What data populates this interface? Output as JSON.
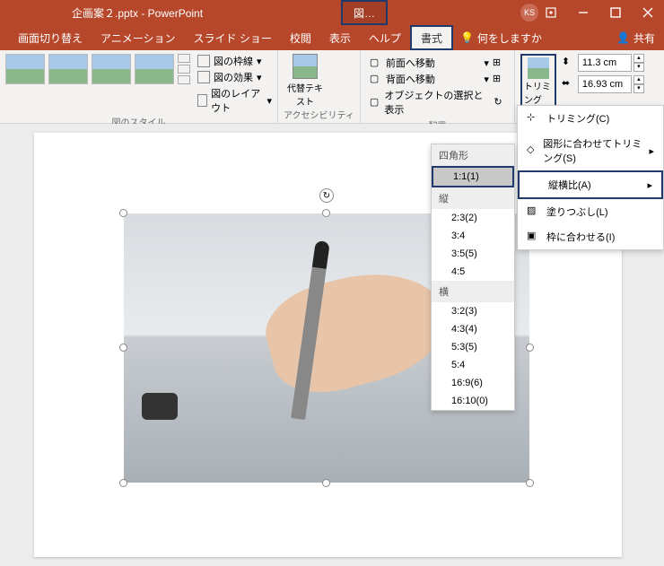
{
  "titlebar": {
    "title": "企画案２.pptx - PowerPoint",
    "context_tab": "図…",
    "user_initials": "KS"
  },
  "menubar": {
    "tabs": [
      "画面切り替え",
      "アニメーション",
      "スライド ショー",
      "校閲",
      "表示",
      "ヘルプ",
      "書式"
    ],
    "tell_me": "何をしますか",
    "share": "共有"
  },
  "ribbon": {
    "style_group": "図のスタイル",
    "pic_border": "図の枠線",
    "pic_effects": "図の効果",
    "pic_layout": "図のレイアウト",
    "alt_text_group": "アクセシビリティ",
    "alt_text_btn": "代替テキスト",
    "arrange_group": "配置",
    "bring_forward": "前面へ移動",
    "send_backward": "背面へ移動",
    "selection_pane": "オブジェクトの選択と表示",
    "trim_label": "トリミング",
    "height_value": "11.3 cm",
    "width_value": "16.93 cm"
  },
  "trim_menu": {
    "crop": "トリミング(C)",
    "crop_to_shape": "図形に合わせてトリミング(S)",
    "aspect_ratio": "縦横比(A)",
    "fill": "塗りつぶし(L)",
    "fit": "枠に合わせる(I)"
  },
  "aspect_menu": {
    "square_header": "四角形",
    "square_items": [
      "1:1(1)"
    ],
    "portrait_header": "縦",
    "portrait_items": [
      "2:3(2)",
      "3:4",
      "3:5(5)",
      "4:5"
    ],
    "landscape_header": "横",
    "landscape_items": [
      "3:2(3)",
      "4:3(4)",
      "5:3(5)",
      "5:4",
      "16:9(6)",
      "16:10(0)"
    ]
  }
}
